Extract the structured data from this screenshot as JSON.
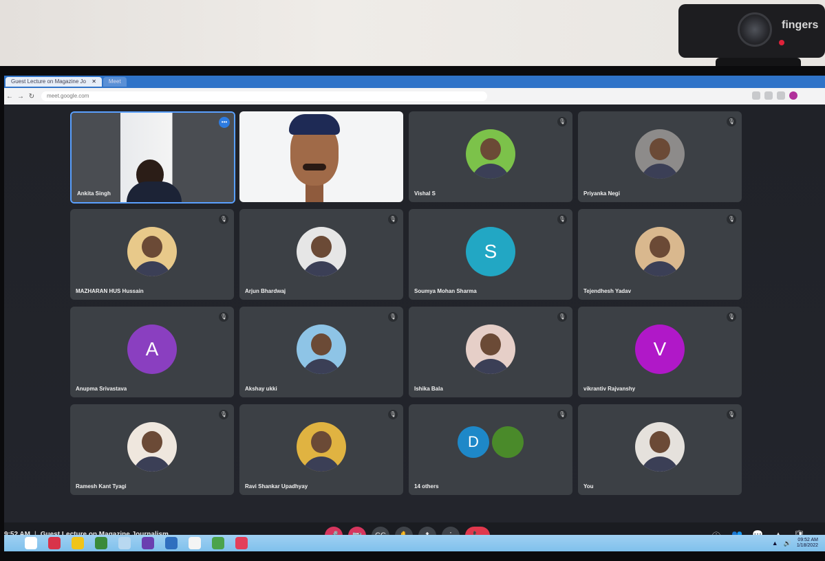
{
  "webcam": {
    "brand": "fingers"
  },
  "browser": {
    "tabs": [
      {
        "label": "Guest Lecture on Magazine Jo"
      },
      {
        "label": "Meet"
      }
    ],
    "url": "meet.google.com"
  },
  "meeting": {
    "time": "9:52 AM",
    "title": "Guest Lecture on Magazine Journalism"
  },
  "participants": [
    {
      "name": "Ankita Singh",
      "type": "video-woman",
      "active": true
    },
    {
      "name": "",
      "type": "video-man"
    },
    {
      "name": "Vishal S",
      "type": "photo",
      "color": "#7cc24a"
    },
    {
      "name": "Priyanka Negi",
      "type": "photo",
      "color": "#8d8b8a"
    },
    {
      "name": "MAZHARAN HUS Hussain",
      "type": "photo",
      "color": "#e8c98a"
    },
    {
      "name": "Arjun Bhardwaj",
      "type": "photo",
      "color": "#e6e6e6"
    },
    {
      "name": "Soumya Mohan Sharma",
      "type": "letter",
      "letter": "S",
      "color": "#22a7c4"
    },
    {
      "name": "Tejendhesh Yadav",
      "type": "photo",
      "color": "#d9b88e"
    },
    {
      "name": "Anupma Srivastava",
      "type": "letter",
      "letter": "A",
      "color": "#8a3fc0"
    },
    {
      "name": "Akshay ukki",
      "type": "photo",
      "color": "#8ec4e6"
    },
    {
      "name": "Ishika Bala",
      "type": "photo",
      "color": "#e6cfc8"
    },
    {
      "name": "vikrantiv Rajvanshy",
      "type": "letter",
      "letter": "V",
      "color": "#b018c8"
    },
    {
      "name": "Ramesh Kant Tyagi",
      "type": "photo",
      "color": "#efe7de"
    },
    {
      "name": "Ravi Shankar Upadhyay",
      "type": "photo",
      "color": "#e0b341"
    },
    {
      "name": "14 others",
      "type": "others",
      "letter": "D",
      "color": "#1e88c8"
    },
    {
      "name": "You",
      "type": "photo",
      "color": "#e5e1dc"
    }
  ],
  "controls": {
    "mic": "🎤",
    "camera": "📷",
    "captions": "CC",
    "raise_hand": "✋",
    "present": "⬆",
    "more": "⋮",
    "hangup": "📞"
  },
  "right_controls": {
    "info": "ⓘ",
    "people": "👥",
    "chat": "💬",
    "activities": "▲",
    "host": "🛡"
  },
  "taskbar": {
    "clock_time": "09:52 AM",
    "clock_date": "1/18/2022"
  }
}
